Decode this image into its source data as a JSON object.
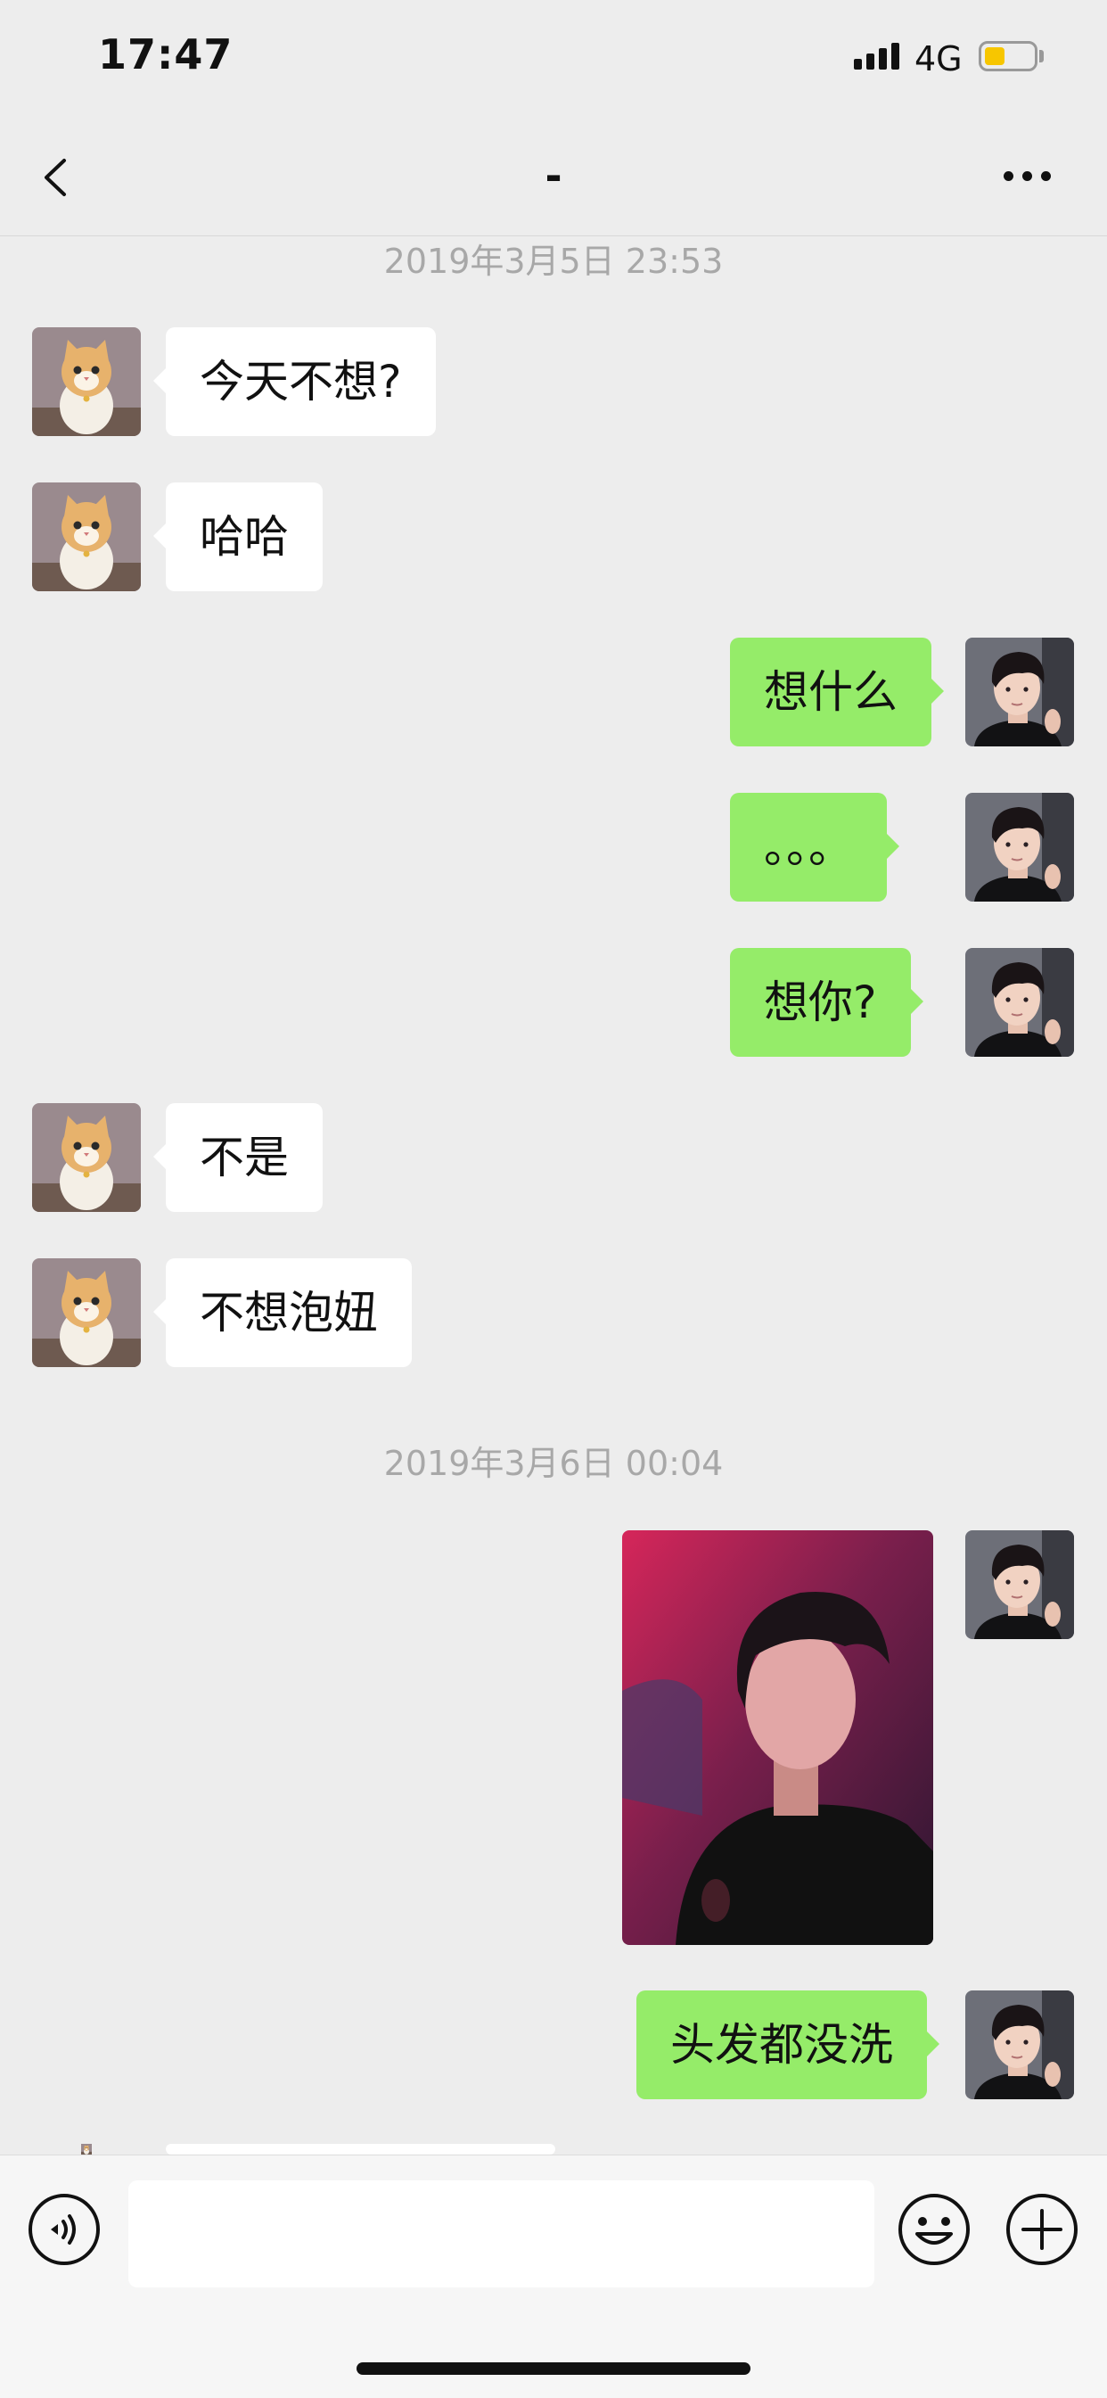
{
  "status_bar": {
    "time": "17:47",
    "network": "4G",
    "battery_color": "#f7c600",
    "signal_icon": "signal-bars-icon"
  },
  "header": {
    "title": "-",
    "back_icon": "chevron-left-icon",
    "more_icon": "more-dots-icon"
  },
  "timestamps": [
    "2019年3月5日 23:53",
    "2019年3月6日 00:04"
  ],
  "messages": [
    {
      "side": "left",
      "type": "text",
      "text": "今天不想?"
    },
    {
      "side": "left",
      "type": "text",
      "text": "哈哈"
    },
    {
      "side": "right",
      "type": "text",
      "text": "想什么"
    },
    {
      "side": "right",
      "type": "text",
      "text": "。。。"
    },
    {
      "side": "right",
      "type": "text",
      "text": "想你?"
    },
    {
      "side": "left",
      "type": "text",
      "text": "不是"
    },
    {
      "side": "left",
      "type": "text",
      "text": "不想泡妞"
    },
    {
      "side": "right",
      "type": "image"
    },
    {
      "side": "right",
      "type": "text",
      "text": "头发都没洗"
    }
  ],
  "colors": {
    "sent_bubble": "#95ec69",
    "received_bubble": "#ffffff",
    "background": "#ededed"
  },
  "input_bar": {
    "voice_icon": "voice-icon",
    "emoji_icon": "emoji-icon",
    "plus_icon": "plus-icon",
    "input_value": ""
  }
}
